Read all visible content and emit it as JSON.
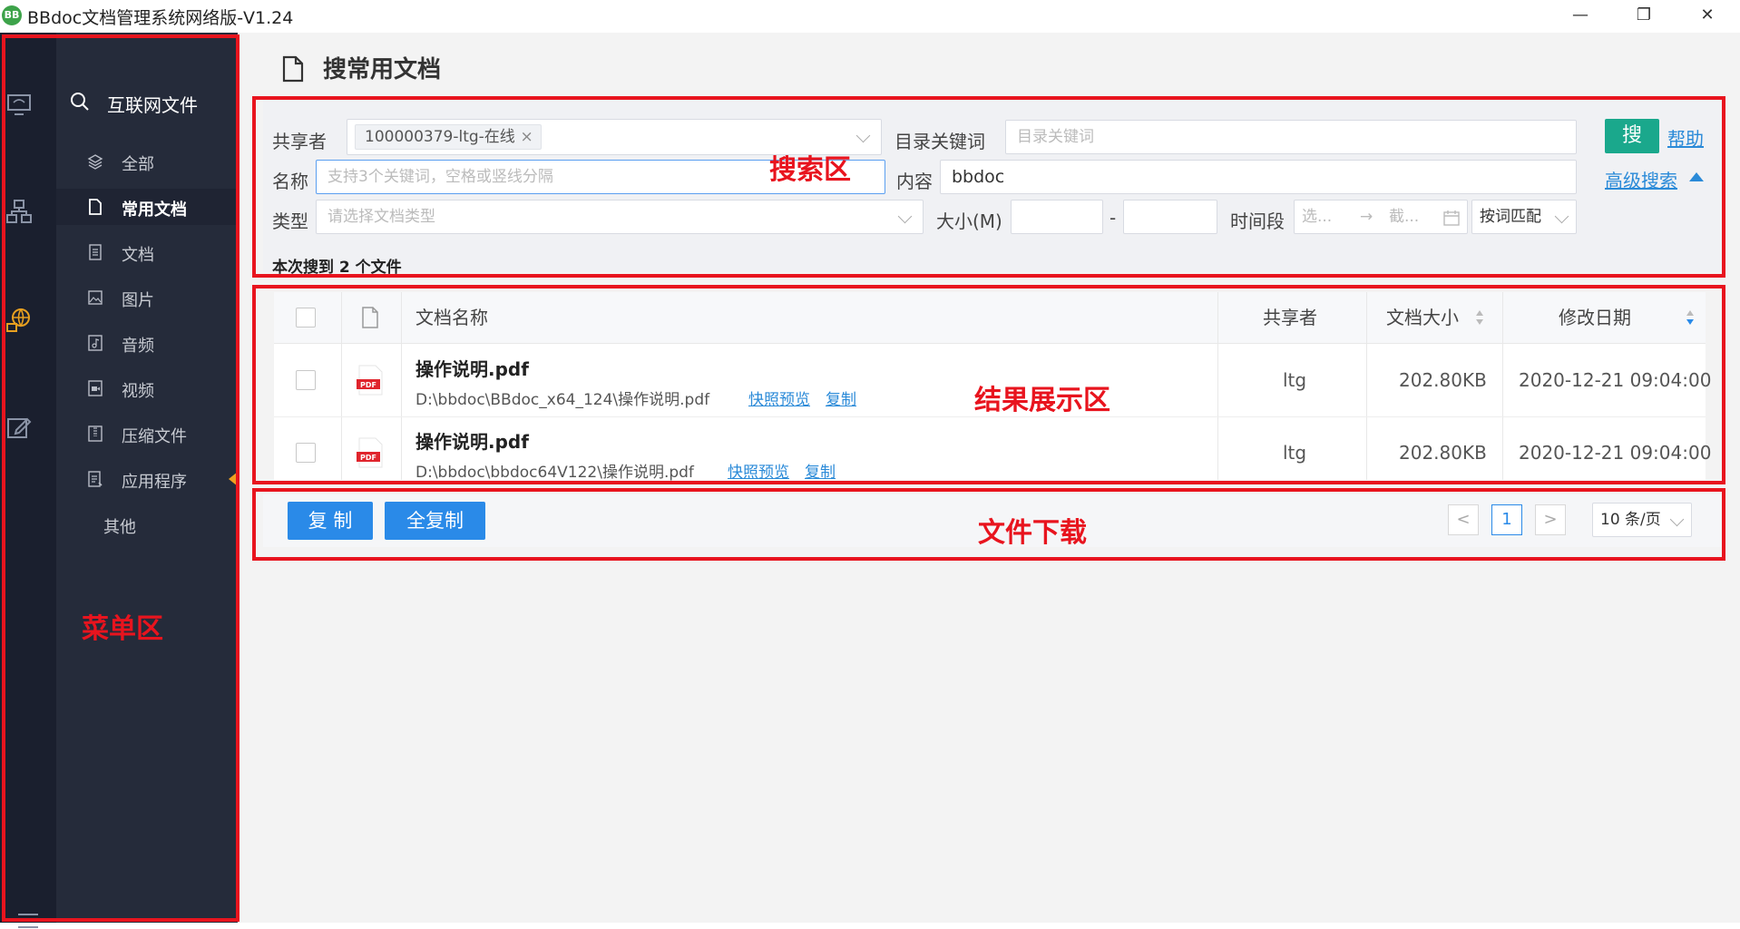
{
  "window": {
    "title": "BBdoc文档管理系统网络版-V1.24",
    "logo_text": "BB",
    "minimize": "—",
    "restore": "❐",
    "close": "✕"
  },
  "rail": {
    "icons": [
      "monitor-icon",
      "network-icon",
      "globe-network-icon",
      "edit-icon"
    ],
    "menu_icon": "hamburger-icon"
  },
  "menu": {
    "header": "互联网文件",
    "items": [
      {
        "label": "全部",
        "icon": "layers-icon"
      },
      {
        "label": "常用文档",
        "icon": "file-icon",
        "active": true
      },
      {
        "label": "文档",
        "icon": "document-icon"
      },
      {
        "label": "图片",
        "icon": "image-icon"
      },
      {
        "label": "音频",
        "icon": "audio-icon"
      },
      {
        "label": "视频",
        "icon": "video-icon"
      },
      {
        "label": "压缩文件",
        "icon": "archive-icon"
      },
      {
        "label": "应用程序",
        "icon": "app-icon"
      },
      {
        "label": "其他",
        "icon": ""
      }
    ]
  },
  "page": {
    "title": "搜常用文档"
  },
  "search": {
    "sharer_label": "共享者",
    "sharer_tag": "100000379-ltg-在线",
    "tag_remove": "×",
    "dir_keyword_label": "目录关键词",
    "dir_keyword_placeholder": "目录关键词",
    "name_label": "名称",
    "name_placeholder": "支持3个关键词，空格或竖线分隔",
    "content_label": "内容",
    "content_value": "bbdoc",
    "type_label": "类型",
    "type_placeholder": "请选择文档类型",
    "size_label": "大小(M)",
    "size_separator": "-",
    "time_label": "时间段",
    "time_start_placeholder": "选...",
    "time_arrow": "→",
    "time_end_placeholder": "截...",
    "match_mode": "按词匹配",
    "search_button": "搜",
    "help_link": "帮助",
    "advanced_link": "高级搜索",
    "result_count": "本次搜到 2 个文件"
  },
  "table": {
    "headers": {
      "name": "文档名称",
      "sharer": "共享者",
      "size": "文档大小",
      "date": "修改日期"
    },
    "rows": [
      {
        "name": "操作说明.pdf",
        "path": "D:\\bbdoc\\BBdoc_x64_124\\操作说明.pdf",
        "preview": "快照预览",
        "copy": "复制",
        "sharer": "ltg",
        "size": "202.80KB",
        "date": "2020-12-21 09:04:00",
        "badge": "PDF"
      },
      {
        "name": "操作说明.pdf",
        "path": "D:\\bbdoc\\bbdoc64V122\\操作说明.pdf",
        "preview": "快照预览",
        "copy": "复制",
        "sharer": "ltg",
        "size": "202.80KB",
        "date": "2020-12-21 09:04:00",
        "badge": "PDF"
      }
    ]
  },
  "footer": {
    "copy_button": "复 制",
    "copy_all_button": "全复制",
    "prev": "<",
    "page": "1",
    "next": ">",
    "page_size": "10 条/页"
  },
  "annotations": {
    "menu_area": "菜单区",
    "search_area": "搜索区",
    "result_area": "结果展示区",
    "download_area": "文件下载",
    "color": "#e8141e"
  }
}
